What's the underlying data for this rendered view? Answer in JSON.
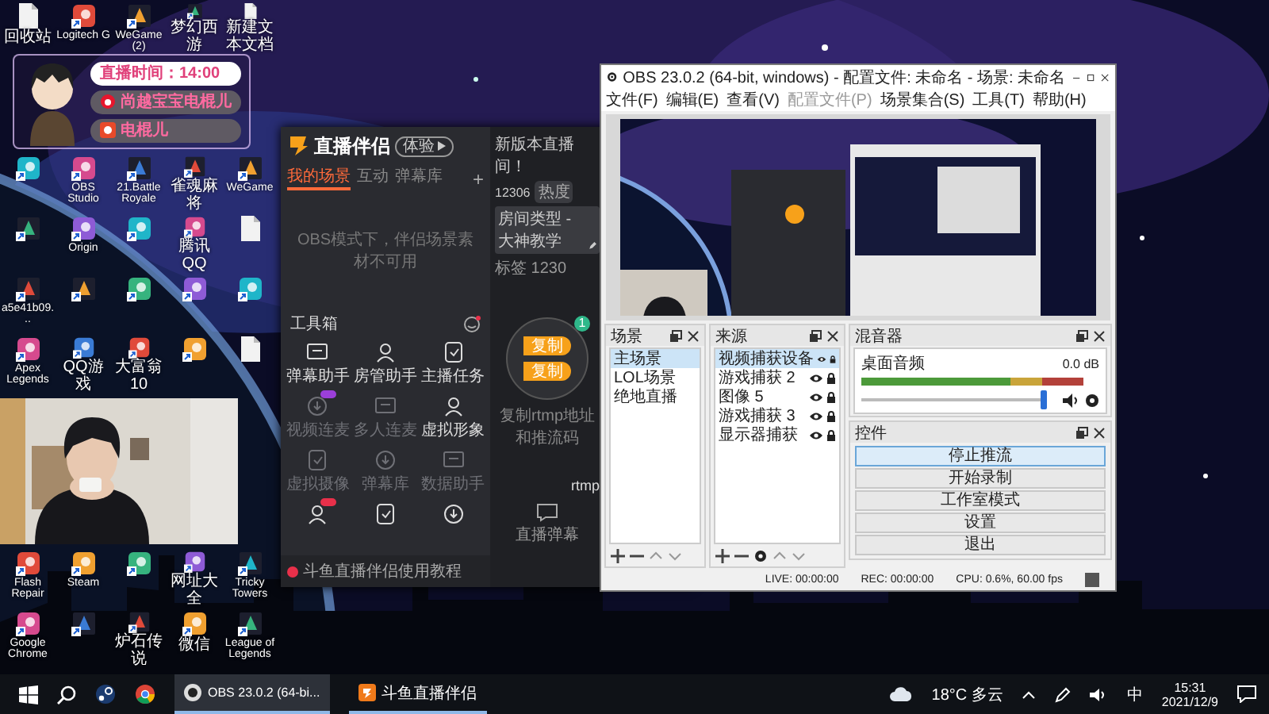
{
  "desktop": {
    "icons_top": [
      [
        {
          "kind": "file",
          "label": "回收站"
        },
        {
          "kind": "app",
          "label": "Logitech G"
        },
        {
          "kind": "game",
          "label": "WeGame (2)"
        },
        {
          "kind": "game",
          "label": "梦幻西游"
        },
        {
          "kind": "file",
          "label": "新建文本文档"
        }
      ],
      [
        {
          "kind": "app"
        },
        {
          "kind": "app",
          "label": "OBS Studio"
        },
        {
          "kind": "game",
          "label": "21.Battle Royale"
        },
        {
          "kind": "game",
          "label": "雀魂麻将"
        },
        {
          "kind": "game",
          "label": "WeGame"
        }
      ],
      [
        {
          "kind": "game"
        },
        {
          "kind": "app",
          "label": "Origin"
        },
        {
          "kind": "app"
        },
        {
          "kind": "app",
          "label": "腾讯QQ"
        },
        {
          "kind": "file"
        }
      ],
      [
        {
          "kind": "game",
          "label": "a5e41b09..."
        },
        {
          "kind": "game"
        },
        {
          "kind": "app"
        },
        {
          "kind": "app"
        },
        {
          "kind": "app"
        }
      ],
      [
        {
          "kind": "app",
          "label": "Apex Legends"
        },
        {
          "kind": "app",
          "label": "QQ游戏"
        },
        {
          "kind": "app",
          "label": "大富翁10"
        },
        {
          "kind": "app"
        },
        {
          "kind": "file"
        }
      ]
    ],
    "overlay": {
      "time": "直播时间：14:00",
      "weibo": "尚越宝宝电棍儿",
      "douyu": "电棍儿"
    },
    "icons_bottom": [
      [
        {
          "kind": "app",
          "label": "Flash Repair"
        },
        {
          "kind": "app",
          "label": "Steam"
        },
        {
          "kind": "app"
        },
        {
          "kind": "app",
          "label": "网址大全"
        },
        {
          "kind": "game",
          "label": "Tricky Towers"
        }
      ],
      [
        {
          "kind": "app",
          "label": "Google Chrome"
        },
        {
          "kind": "game"
        },
        {
          "kind": "game",
          "label": "炉石传说"
        },
        {
          "kind": "app",
          "label": "微信"
        },
        {
          "kind": "game",
          "label": "League of Legends"
        }
      ]
    ]
  },
  "stream_app": {
    "title": "直播伴侣",
    "mode": "体验",
    "tabs": [
      {
        "label": "我的场景",
        "selected": true
      },
      {
        "label": "互动",
        "selected": false
      },
      {
        "label": "弹幕库",
        "selected": false
      }
    ],
    "add": "+",
    "notice": "OBS模式下，伴侣场景素材不可用",
    "toolbox": "工具箱",
    "tools": [
      {
        "label": "弹幕助手",
        "disabled": false
      },
      {
        "label": "房管助手",
        "disabled": false
      },
      {
        "label": "主播任务",
        "disabled": false
      },
      {
        "label": "视频连麦",
        "disabled": true,
        "color": "#9b3fd9"
      },
      {
        "label": "多人连麦",
        "disabled": true
      },
      {
        "label": "虚拟形象",
        "disabled": false
      },
      {
        "label": "虚拟摄像",
        "disabled": true
      },
      {
        "label": "弹幕库",
        "disabled": true
      },
      {
        "label": "数据助手",
        "disabled": true
      },
      {
        "disabled": false,
        "color": "#e8304a"
      },
      {
        "disabled": false
      },
      {
        "disabled": false
      }
    ],
    "tutorial": "斗鱼直播伴侣使用教程",
    "room": {
      "name": "新版本直播间！",
      "id": "12306",
      "heat": "热度",
      "type": "房间类型 - 大神教学",
      "tag": "标签 1230"
    },
    "push": {
      "buttons": [
        "复制",
        "复制"
      ],
      "badge": "1",
      "caption": "复制rtmp地址和推流码",
      "rtmp": "rtmp"
    },
    "danmu": "直播弹幕"
  },
  "obs": {
    "title": "OBS 23.0.2 (64-bit, windows) - 配置文件: 未命名 - 场景: 未命名",
    "menu": [
      {
        "label": "文件(F)",
        "disabled": false
      },
      {
        "label": "编辑(E)",
        "disabled": false
      },
      {
        "label": "查看(V)",
        "disabled": false
      },
      {
        "label": "配置文件(P)",
        "disabled": true
      },
      {
        "label": "场景集合(S)",
        "disabled": false
      },
      {
        "label": "工具(T)",
        "disabled": false
      },
      {
        "label": "帮助(H)",
        "disabled": false
      }
    ],
    "scenes": {
      "title": "场景",
      "items": [
        {
          "label": "主场景",
          "selected": true
        },
        {
          "label": "LOL场景",
          "selected": false
        },
        {
          "label": "绝地直播",
          "selected": false
        }
      ]
    },
    "sources": {
      "title": "来源",
      "items": [
        {
          "label": "视频捕获设备",
          "selected": true
        },
        {
          "label": "游戏捕获 2",
          "selected": false
        },
        {
          "label": "图像 5",
          "selected": false
        },
        {
          "label": "游戏捕获 3",
          "selected": false
        },
        {
          "label": "显示器捕获",
          "selected": false
        }
      ]
    },
    "mixer": {
      "title": "混音器",
      "channels": [
        {
          "name": "桌面音频",
          "reading": "0.0 dB",
          "level": 1
        }
      ]
    },
    "controls": {
      "title": "控件",
      "buttons": [
        {
          "label": "停止推流",
          "selected": true
        },
        {
          "label": "开始录制",
          "selected": false
        },
        {
          "label": "工作室模式",
          "selected": false
        },
        {
          "label": "设置",
          "selected": false
        },
        {
          "label": "退出",
          "selected": false
        }
      ]
    },
    "status": {
      "live": "LIVE: 00:00:00",
      "rec": "REC: 00:00:00",
      "cpu": "CPU: 0.6%, 60.00 fps"
    }
  },
  "taskbar": {
    "tasks": [
      {
        "kind": "obs",
        "label": "OBS 23.0.2 (64-bi...",
        "selected": true
      },
      {
        "kind": "douyu",
        "label": "斗鱼直播伴侣",
        "selected": false
      }
    ],
    "weather": "18°C 多云",
    "ime": "中",
    "time": "15:31",
    "date": "2021/12/9"
  }
}
